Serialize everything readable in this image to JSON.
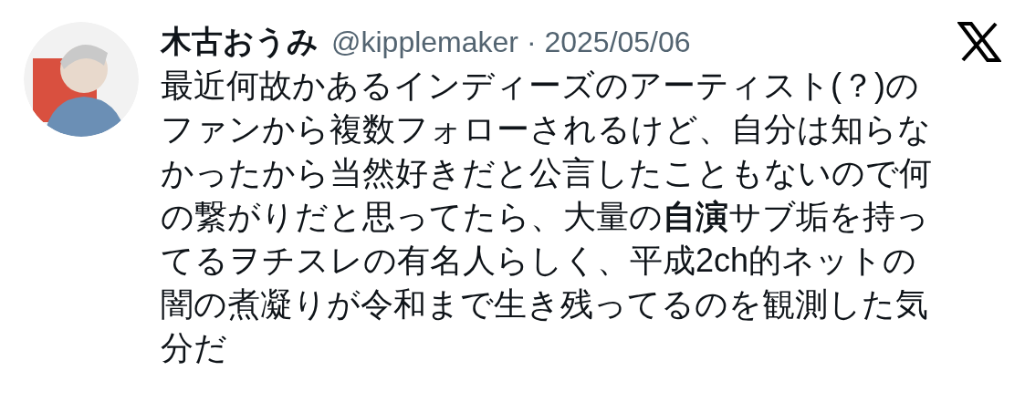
{
  "tweet": {
    "author_name": "木古おうみ",
    "handle_date": "@kipplemaker · 2025/05/06",
    "lines": [
      "最近何故かあるインディーズのアーティスト(？)の",
      "ファンから複数フォローされるけど、自分は知らな",
      "かったから当然好きだと公言したこともないので何",
      "の繋がりだと思ってたら、大量の**自演**サブ垢を持っ",
      "てるヲチスレの有名人らしく、平成2ch的ネットの",
      "闇の煮凝りが令和まで生き残ってるのを観測した気",
      "分だ"
    ]
  }
}
